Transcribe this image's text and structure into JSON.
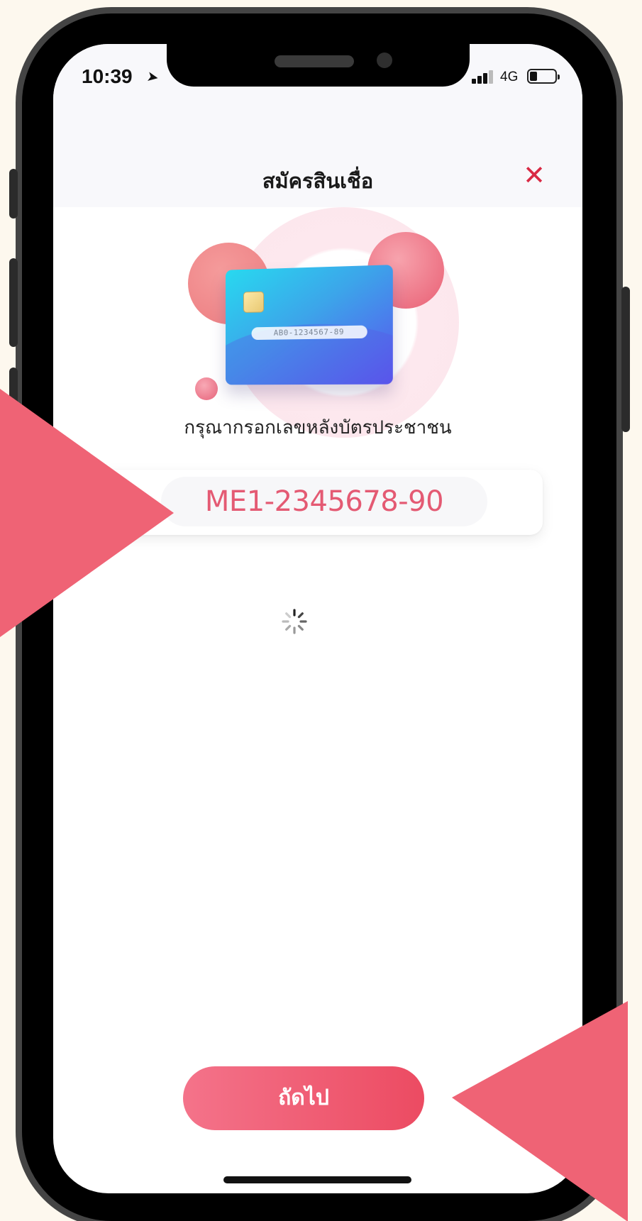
{
  "status_bar": {
    "time": "10:39",
    "network": "4G"
  },
  "header": {
    "title": "สมัครสินเชื่อ",
    "close_icon": "close-icon"
  },
  "illustration": {
    "card_number": "AB0-1234567-89"
  },
  "form": {
    "prompt": "กรุณากรอกเลขหลังบัตรประชาชน",
    "laser_code_value": "ME1-2345678-90"
  },
  "footer": {
    "next_label": "ถัดไป"
  },
  "colors": {
    "accent": "#ef6375",
    "input_text": "#e45a73",
    "close": "#d92a44"
  }
}
